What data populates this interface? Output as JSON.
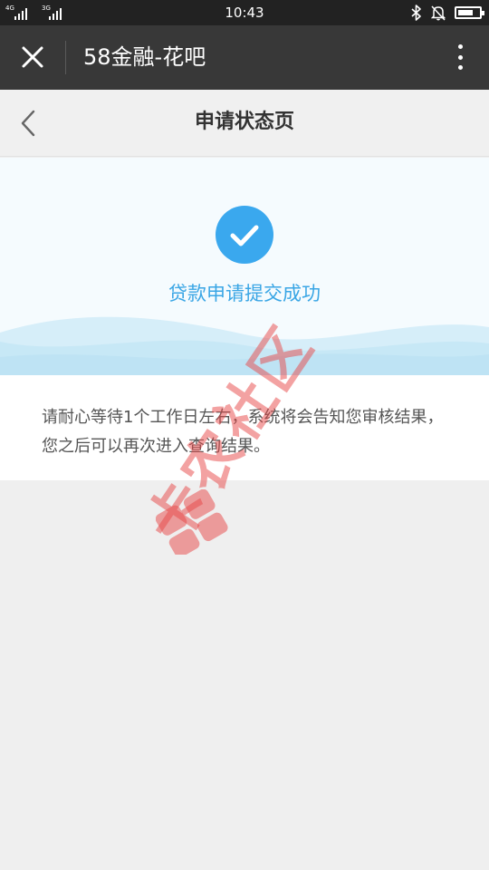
{
  "status_bar": {
    "network_1": "4G",
    "network_1b": "4G",
    "network_2": "3G",
    "time": "10:43"
  },
  "header": {
    "title": "58金融-花吧",
    "close_icon": "close-icon",
    "more_icon": "more-vertical-icon"
  },
  "page": {
    "back_icon": "chevron-left-icon",
    "title": "申请状态页"
  },
  "success": {
    "icon": "check-circle-icon",
    "message": "贷款申请提交成功"
  },
  "info": {
    "message": "请耐心等待1个工作日左右，系统将会告知您审核结果，您之后可以再次进入查询结果。"
  },
  "watermark": {
    "text": "卡农社区"
  },
  "colors": {
    "status_bar_bg": "#222222",
    "header_bg": "#383838",
    "accent": "#3aa6e5",
    "check_circle": "#3aa8ee",
    "page_bg": "#efefef",
    "watermark": "#e84646"
  }
}
